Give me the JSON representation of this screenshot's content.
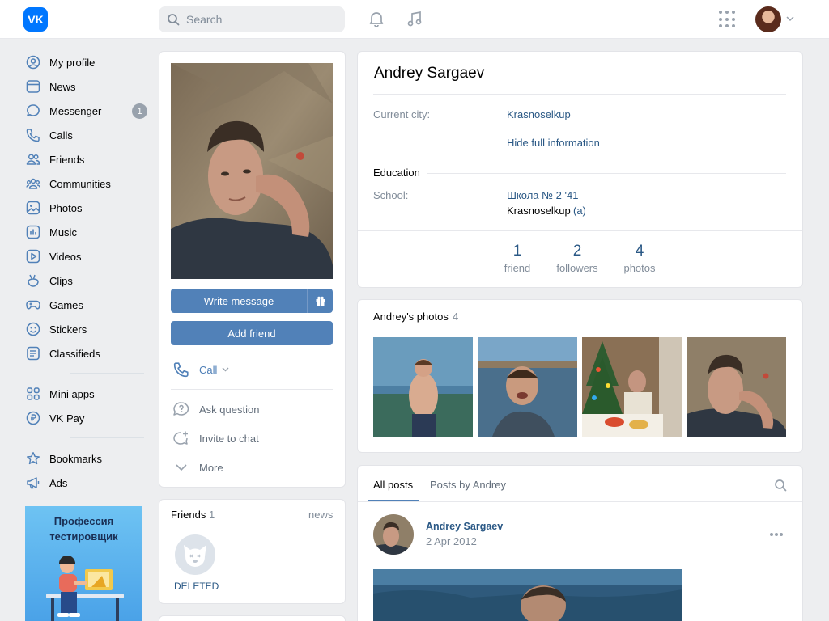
{
  "header": {
    "logo_text": "VK",
    "search_placeholder": "Search"
  },
  "nav": {
    "items": [
      {
        "label": "My profile",
        "icon": "user-circle-icon"
      },
      {
        "label": "News",
        "icon": "news-icon"
      },
      {
        "label": "Messenger",
        "icon": "message-icon",
        "badge": "1"
      },
      {
        "label": "Calls",
        "icon": "phone-icon"
      },
      {
        "label": "Friends",
        "icon": "friends-icon"
      },
      {
        "label": "Communities",
        "icon": "communities-icon"
      },
      {
        "label": "Photos",
        "icon": "photo-icon"
      },
      {
        "label": "Music",
        "icon": "music-icon"
      },
      {
        "label": "Videos",
        "icon": "video-icon"
      },
      {
        "label": "Clips",
        "icon": "clips-icon"
      },
      {
        "label": "Games",
        "icon": "gamepad-icon"
      },
      {
        "label": "Stickers",
        "icon": "smile-icon"
      },
      {
        "label": "Classifieds",
        "icon": "classifieds-icon"
      }
    ],
    "items2": [
      {
        "label": "Mini apps",
        "icon": "apps-grid-icon"
      },
      {
        "label": "VK Pay",
        "icon": "vk-pay-icon"
      }
    ],
    "items3": [
      {
        "label": "Bookmarks",
        "icon": "star-icon"
      },
      {
        "label": "Ads",
        "icon": "megaphone-icon"
      }
    ],
    "promo_title": "Профессия тестировщик"
  },
  "profile": {
    "write_message": "Write message",
    "add_friend": "Add friend",
    "call": "Call",
    "ask_question": "Ask question",
    "invite_to_chat": "Invite to chat",
    "more": "More"
  },
  "friends_card": {
    "title": "Friends",
    "count": "1",
    "link": "news",
    "friend_name": "DELETED"
  },
  "info": {
    "name": "Andrey Sargaev",
    "city_label": "Current city:",
    "city_value": "Krasnoselkup",
    "hide_full": "Hide full information",
    "education_heading": "Education",
    "school_label": "School:",
    "school_value": "Школа № 2 '41",
    "school_city": "Krasnoselkup",
    "school_suffix": "(a)",
    "counters": [
      {
        "num": "1",
        "cap": "friend"
      },
      {
        "num": "2",
        "cap": "followers"
      },
      {
        "num": "4",
        "cap": "photos"
      }
    ]
  },
  "photos_card": {
    "title": "Andrey's photos",
    "count": "4"
  },
  "posts": {
    "tab_all": "All posts",
    "tab_by": "Posts by Andrey",
    "author": "Andrey Sargaev",
    "date": "2 Apr 2012"
  },
  "colors": {
    "accent": "#5181b8",
    "link": "#2a5885",
    "brand": "#0077ff",
    "page_bg": "#edeef0"
  }
}
